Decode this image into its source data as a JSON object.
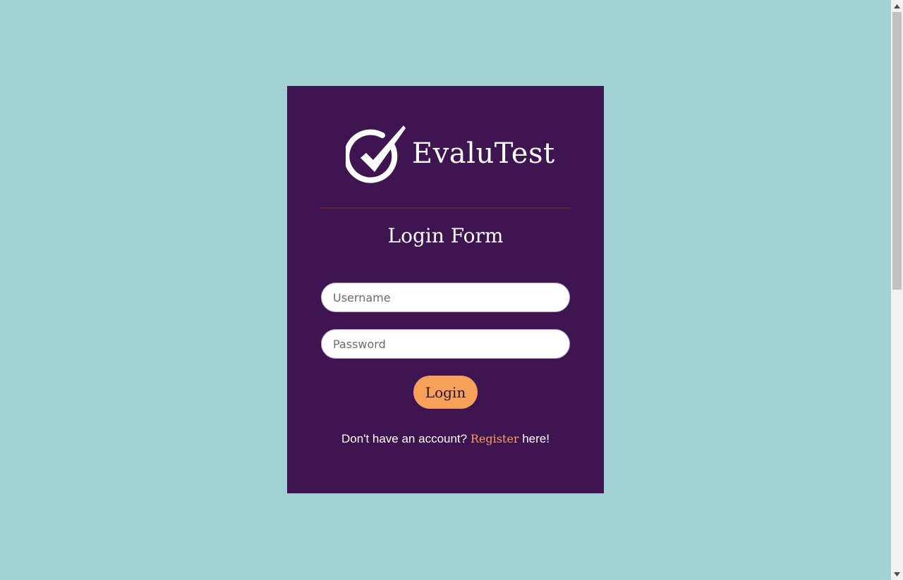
{
  "brand": {
    "name": "EvaluTest",
    "logo_icon": "check-circle-icon"
  },
  "form": {
    "title": "Login Form",
    "username_placeholder": "Username",
    "password_placeholder": "Password",
    "login_label": "Login"
  },
  "register": {
    "prefix": "Don't have an account? ",
    "link_label": "Register",
    "suffix": " here!"
  },
  "colors": {
    "page_background": "#a1d1d5",
    "card_background": "#3e1550",
    "accent": "#f7a05a",
    "divider": "#6a2530",
    "text_on_card": "#ffffff"
  }
}
